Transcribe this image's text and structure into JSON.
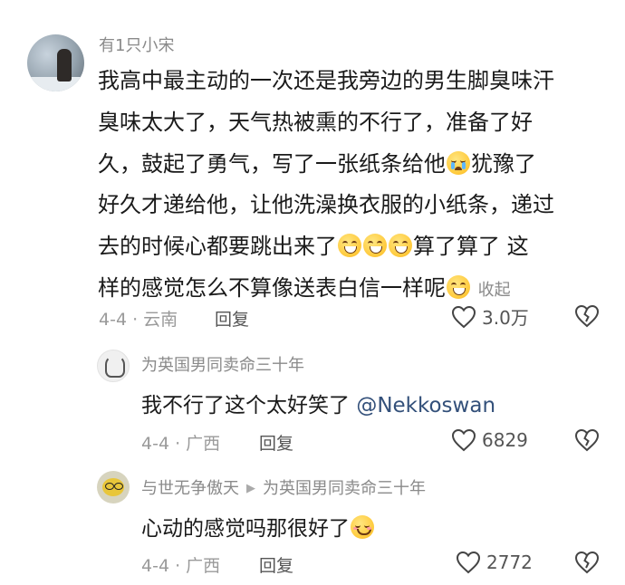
{
  "comment": {
    "username": "有1只小宋",
    "lines": [
      "我高中最主动的一次还是我旁边的男生脚臭味汗",
      "臭味太大了，天气热被熏的不行了，准备了好",
      "久，鼓起了勇气，写了一张纸条给他",
      "犹豫了",
      "好久才递给他，让他洗澡换衣服的小纸条，递过",
      "去的时候心都要跳出来了",
      "算了算了 这",
      "样的感觉怎么不算像送表白信一样呢",
      "收起"
    ],
    "date_location": "4-4 · 云南",
    "reply_label": "回复",
    "likes": "3.0万"
  },
  "replies": [
    {
      "username": "为英国男同卖命三十年",
      "text": "我不行了这个太好笑了 ",
      "mention": "@Nekkoswan",
      "date_location": "4-4 · 广西",
      "reply_label": "回复",
      "likes": "6829"
    },
    {
      "username": "与世无争傲天",
      "reply_to": "为英国男同卖命三十年",
      "text": "心动的感觉吗那很好了",
      "date_location": "4-4 · 广西",
      "reply_label": "回复",
      "likes": "2772"
    }
  ],
  "icons": {
    "like": "heart-outline-icon",
    "dislike": "broken-heart-icon",
    "emoji_cry": "crying-face-emoji",
    "emoji_grin": "grinning-face-emoji",
    "emoji_blush": "smiling-face-emoji",
    "reply_arrow": "play-arrow-icon"
  },
  "colors": {
    "text": "#1a1a1a",
    "meta": "#9a9a9a",
    "mention": "#33507a"
  }
}
